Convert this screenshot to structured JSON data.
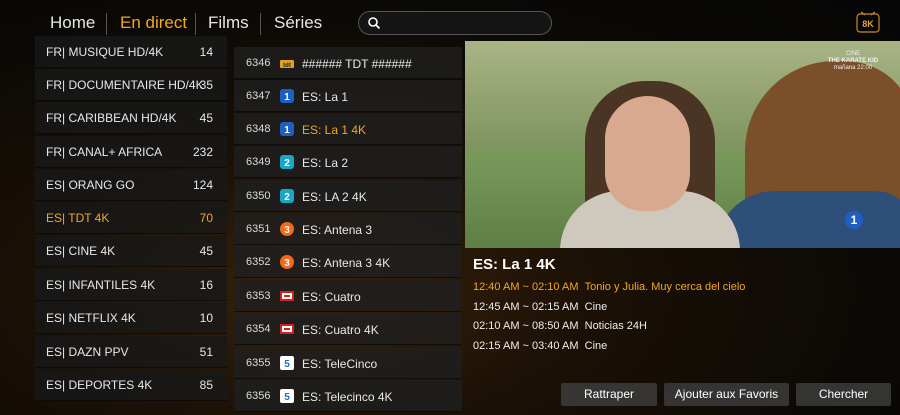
{
  "nav": {
    "items": [
      {
        "label": "Home",
        "active": false
      },
      {
        "label": "En direct",
        "active": true
      },
      {
        "label": "Films",
        "active": false
      },
      {
        "label": "Séries",
        "active": false
      }
    ],
    "search_placeholder": "",
    "logo_icon": "8k-logo-icon",
    "logo_text": "8K"
  },
  "categories": [
    {
      "name": "FR| MUSIQUE HD/4K",
      "count": "14"
    },
    {
      "name": "FR| DOCUMENTAIRE HD/4K",
      "count": "35"
    },
    {
      "name": "FR| CARIBBEAN HD/4K",
      "count": "45"
    },
    {
      "name": "FR| CANAL+ AFRICA",
      "count": "232"
    },
    {
      "name": "ES| ORANG GO",
      "count": "124"
    },
    {
      "name": "ES| TDT 4K",
      "count": "70",
      "active": true
    },
    {
      "name": "ES| CINE 4K",
      "count": "45"
    },
    {
      "name": "ES| INFANTILES 4K",
      "count": "16"
    },
    {
      "name": "ES| NETFLIX 4K",
      "count": "10"
    },
    {
      "name": "ES| DAZN PPV",
      "count": "51"
    },
    {
      "name": "ES| DEPORTES 4K",
      "count": "85"
    }
  ],
  "channels": [
    {
      "number": "6346",
      "title": "###### TDT ######",
      "icon": "tdt-logo-icon"
    },
    {
      "number": "6347",
      "title": "ES: La 1",
      "icon": "la1-logo-icon"
    },
    {
      "number": "6348",
      "title": "ES: La 1 4K",
      "icon": "la1-logo-icon",
      "active": true
    },
    {
      "number": "6349",
      "title": "ES: La 2",
      "icon": "la2-logo-icon"
    },
    {
      "number": "6350",
      "title": "ES: LA 2 4K",
      "icon": "la2-logo-icon"
    },
    {
      "number": "6351",
      "title": "ES: Antena 3",
      "icon": "antena3-logo-icon"
    },
    {
      "number": "6352",
      "title": "ES: Antena 3 4K",
      "icon": "antena3-logo-icon"
    },
    {
      "number": "6353",
      "title": "ES: Cuatro",
      "icon": "cuatro-logo-icon"
    },
    {
      "number": "6354",
      "title": "ES: Cuatro 4K",
      "icon": "cuatro-logo-icon"
    },
    {
      "number": "6355",
      "title": "ES: TeleCinco",
      "icon": "telecinco-logo-icon"
    },
    {
      "number": "6356",
      "title": "ES: Telecinco 4K",
      "icon": "telecinco-logo-icon"
    }
  ],
  "preview": {
    "watermark_line1": "CINE",
    "watermark_line2": "THE KARATE KID",
    "watermark_line3": "mañana 22:00",
    "channel_badge": "1"
  },
  "info": {
    "title": "ES: La 1 4K",
    "epg": [
      {
        "time": "12:40 AM ~ 02:10 AM",
        "program": "Tonio y Julia. Muy cerca del cielo",
        "active": true
      },
      {
        "time": "12:45 AM ~ 02:15 AM",
        "program": "Cine"
      },
      {
        "time": "02:10 AM ~ 08:50 AM",
        "program": "Noticias 24H"
      },
      {
        "time": "02:15 AM ~ 03:40 AM",
        "program": "Cine"
      }
    ]
  },
  "buttons": {
    "catchup": "Rattraper",
    "favorites": "Ajouter aux Favoris",
    "search": "Chercher"
  },
  "colors": {
    "accent": "#f5a623",
    "row_bg": "#1e1e1e",
    "button_bg": "#3c3c3c"
  }
}
